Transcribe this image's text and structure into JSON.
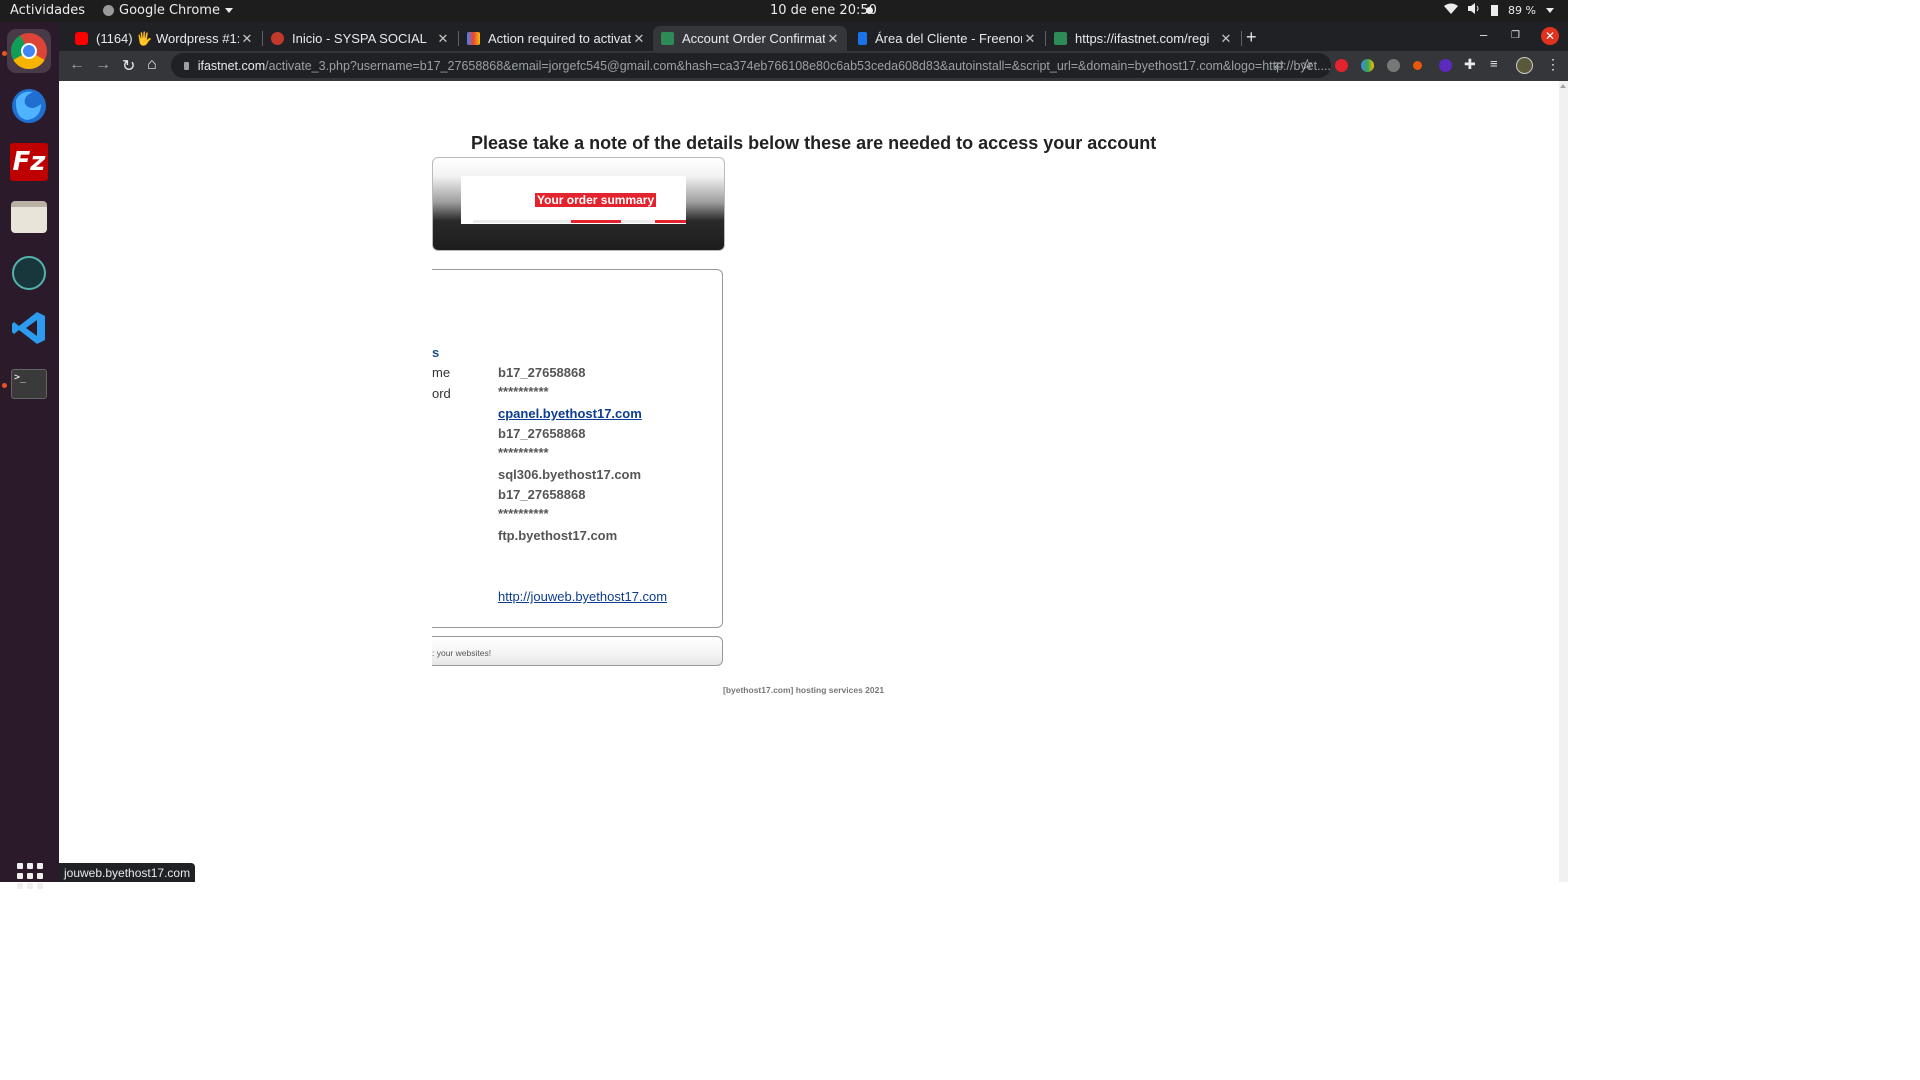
{
  "system": {
    "activities": "Actividades",
    "app_name": "Google Chrome",
    "clock": "10 de ene  20:50",
    "battery": "89 %"
  },
  "tabs": [
    {
      "title": "(1164) 🖐 Wordpress #1: I",
      "favicon_color": "#ff0000"
    },
    {
      "title": "Inicio - SYSPA SOCIAL",
      "favicon_color": "#c0392b"
    },
    {
      "title": "Action required to activat",
      "favicon_color": "#4285f4"
    },
    {
      "title": "Account Order Confirmat",
      "favicon_color": "#2e8b57"
    },
    {
      "title": "Área del Cliente - Freenon",
      "favicon_color": "#1a73e8"
    },
    {
      "title": "https://ifastnet.com/regi",
      "favicon_color": "#2e8b57"
    }
  ],
  "url": {
    "host": "ifastnet.com",
    "path": "/activate_3.php?username=b17_27658868&email=jorgefc545@gmail.com&hash=ca374eb766108e80c6ab53ceda608d83&autoinstall=&script_url=&domain=byethost17.com&logo=http://byet...."
  },
  "page": {
    "heading": "Please take a note of the details below these are needed to access your account",
    "summary_label": "Your order summary",
    "labels": [
      "s",
      "me",
      "ord"
    ],
    "values": [
      "b17_27658868",
      "**********",
      "cpanel.byethost17.com",
      "b17_27658868",
      "**********",
      "sql306.byethost17.com",
      "b17_27658868",
      "**********",
      "ftp.byethost17.com"
    ],
    "site_link": "http://jouweb.byethost17.com",
    "footer_text": ": your websites!",
    "copyright": "[byethost17.com] hosting services 2021"
  },
  "status_url": "jouweb.byethost17.com",
  "colors": {
    "accent_red": "#e3232d",
    "link_blue": "#0d3c91",
    "dock_bg": "#2b1a29",
    "ubuntu_orange": "#e95420"
  }
}
